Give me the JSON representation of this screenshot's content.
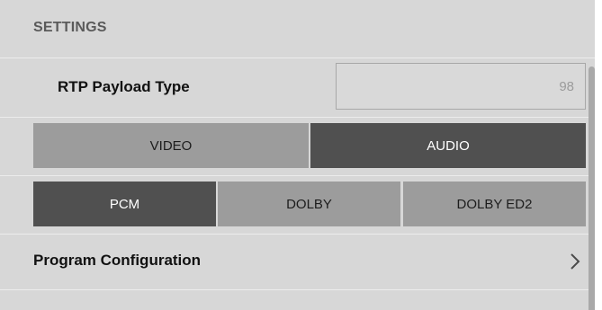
{
  "header": {
    "title": "SETTINGS"
  },
  "rtp": {
    "label": "RTP Payload Type",
    "value": "98"
  },
  "media_type": {
    "options": [
      {
        "label": "VIDEO",
        "selected": false
      },
      {
        "label": "AUDIO",
        "selected": true
      }
    ]
  },
  "audio_format": {
    "options": [
      {
        "label": "PCM",
        "selected": true
      },
      {
        "label": "DOLBY",
        "selected": false
      },
      {
        "label": "DOLBY ED2",
        "selected": false
      }
    ]
  },
  "program": {
    "label": "Program Configuration",
    "icon": "chevron-right-icon"
  },
  "colors": {
    "panel_background": "#d7d7d7",
    "segment_selected": "#505050",
    "segment_unselected": "#9c9c9c",
    "divider": "#ececec",
    "scrollbar": "#a9a9a9"
  }
}
